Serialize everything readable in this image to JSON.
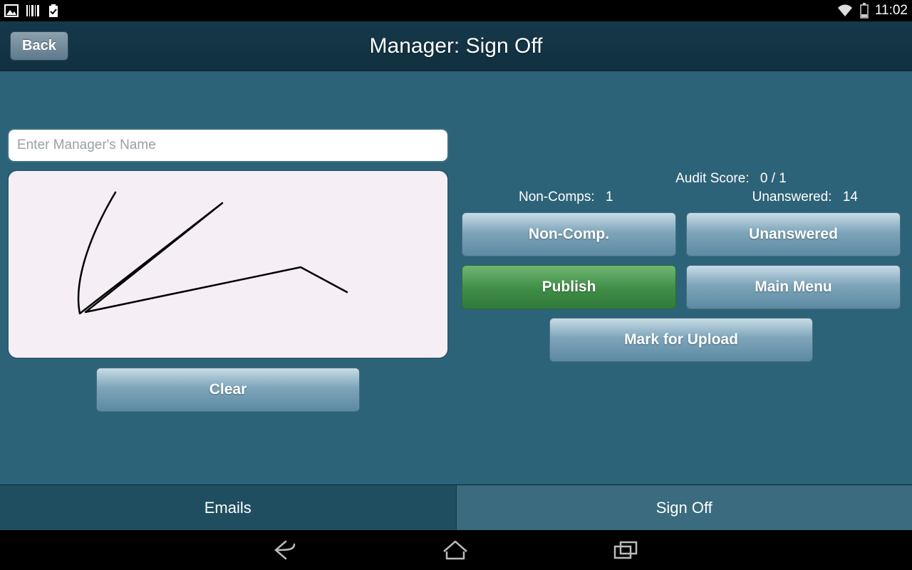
{
  "status_bar": {
    "time": "11:02"
  },
  "header": {
    "back_label": "Back",
    "title": "Manager: Sign Off"
  },
  "left": {
    "name_placeholder": "Enter Manager's Name",
    "clear_label": "Clear"
  },
  "right": {
    "audit_score_label": "Audit Score:",
    "audit_score_value": "0 / 1",
    "noncomps_label": "Non-Comps:",
    "noncomps_value": "1",
    "unanswered_label": "Unanswered:",
    "unanswered_value": "14",
    "btn_noncomp": "Non-Comp.",
    "btn_unanswered": "Unanswered",
    "btn_publish": "Publish",
    "btn_mainmenu": "Main Menu",
    "btn_markupload": "Mark for Upload"
  },
  "bottom_tabs": {
    "emails": "Emails",
    "signoff": "Sign Off"
  }
}
